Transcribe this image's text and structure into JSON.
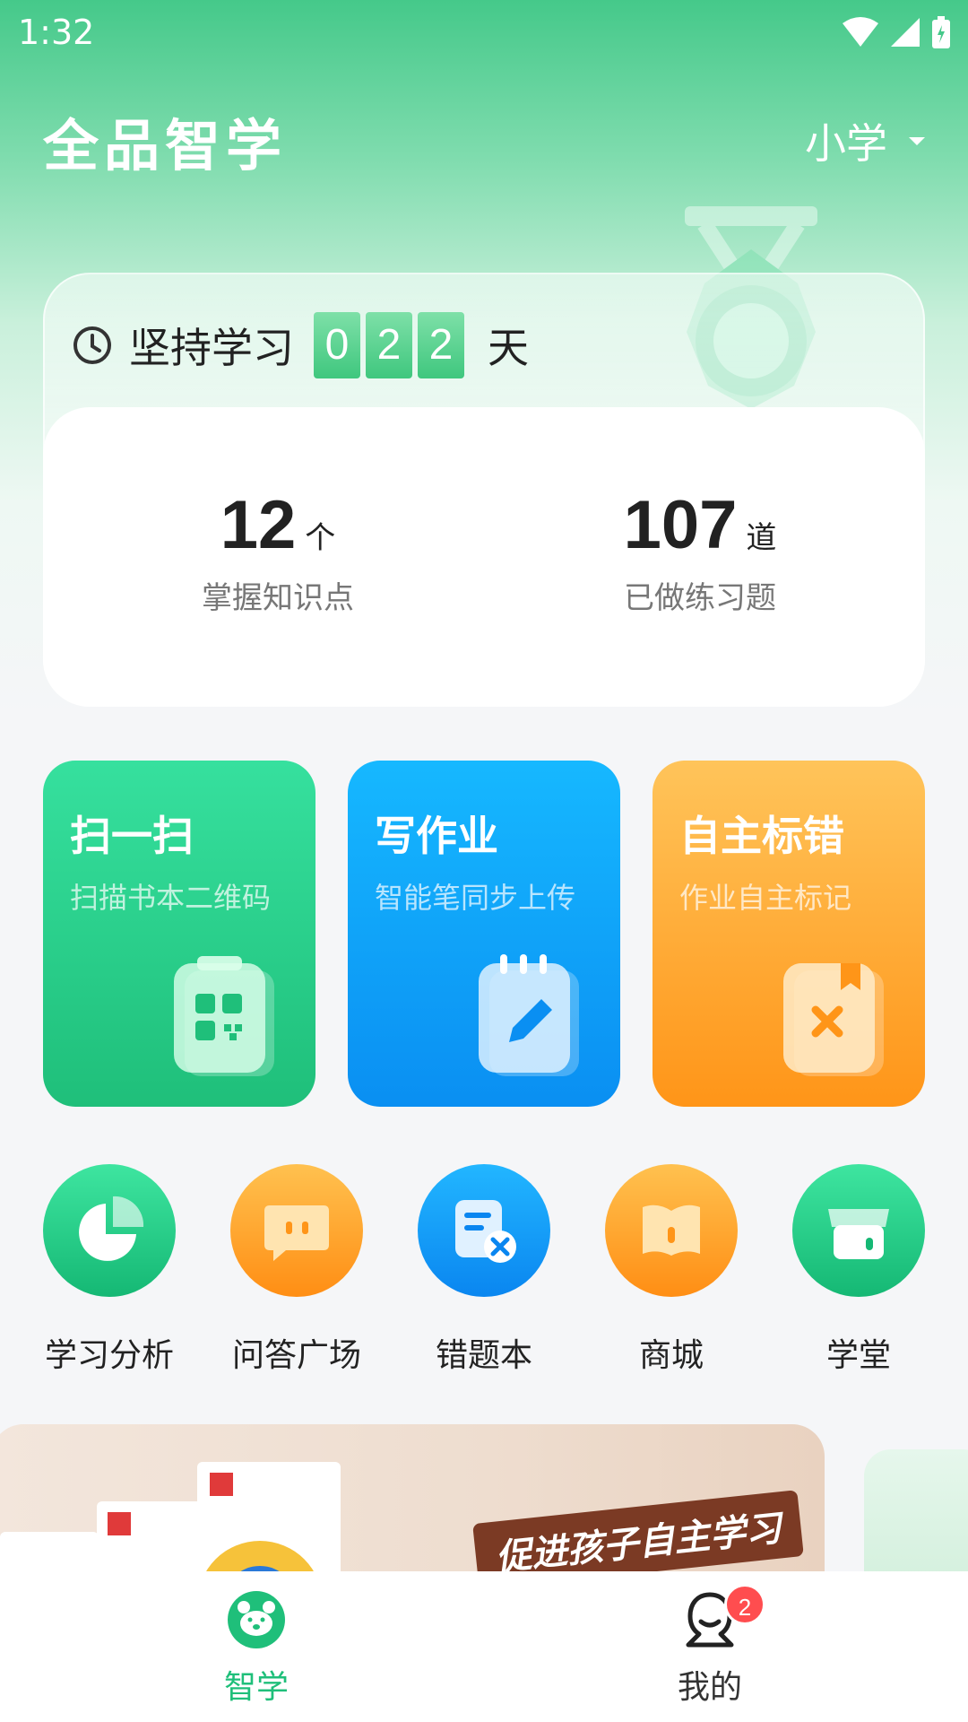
{
  "status_bar": {
    "time": "1:32"
  },
  "header": {
    "title": "全品智学",
    "grade": "小学"
  },
  "streak": {
    "label": "坚持学习",
    "digits": [
      "0",
      "2",
      "2"
    ],
    "unit": "天"
  },
  "stats": [
    {
      "value": "12",
      "unit": "个",
      "label": "掌握知识点"
    },
    {
      "value": "107",
      "unit": "道",
      "label": "已做练习题"
    }
  ],
  "features": [
    {
      "title": "扫一扫",
      "subtitle": "扫描书本二维码",
      "icon": "qr-clipboard-icon"
    },
    {
      "title": "写作业",
      "subtitle": "智能笔同步上传",
      "icon": "notebook-pen-icon"
    },
    {
      "title": "自主标错",
      "subtitle": "作业自主标记",
      "icon": "bookmark-x-icon"
    }
  ],
  "shortcuts": [
    {
      "label": "学习分析",
      "icon": "pie-chart-icon"
    },
    {
      "label": "问答广场",
      "icon": "chat-bubble-icon"
    },
    {
      "label": "错题本",
      "icon": "error-note-icon"
    },
    {
      "label": "商城",
      "icon": "open-book-icon"
    },
    {
      "label": "学堂",
      "icon": "store-icon"
    }
  ],
  "banner": {
    "slogan": "促进孩子自主学习"
  },
  "bottom_nav": {
    "items": [
      {
        "label": "智学",
        "icon": "bear-face-icon",
        "active": true
      },
      {
        "label": "我的",
        "icon": "user-icon",
        "badge": "2"
      }
    ]
  },
  "colors": {
    "primary": "#1fbf7a",
    "blue": "#0a8ff2",
    "orange": "#ff9518",
    "badge": "#ff4d4f"
  }
}
